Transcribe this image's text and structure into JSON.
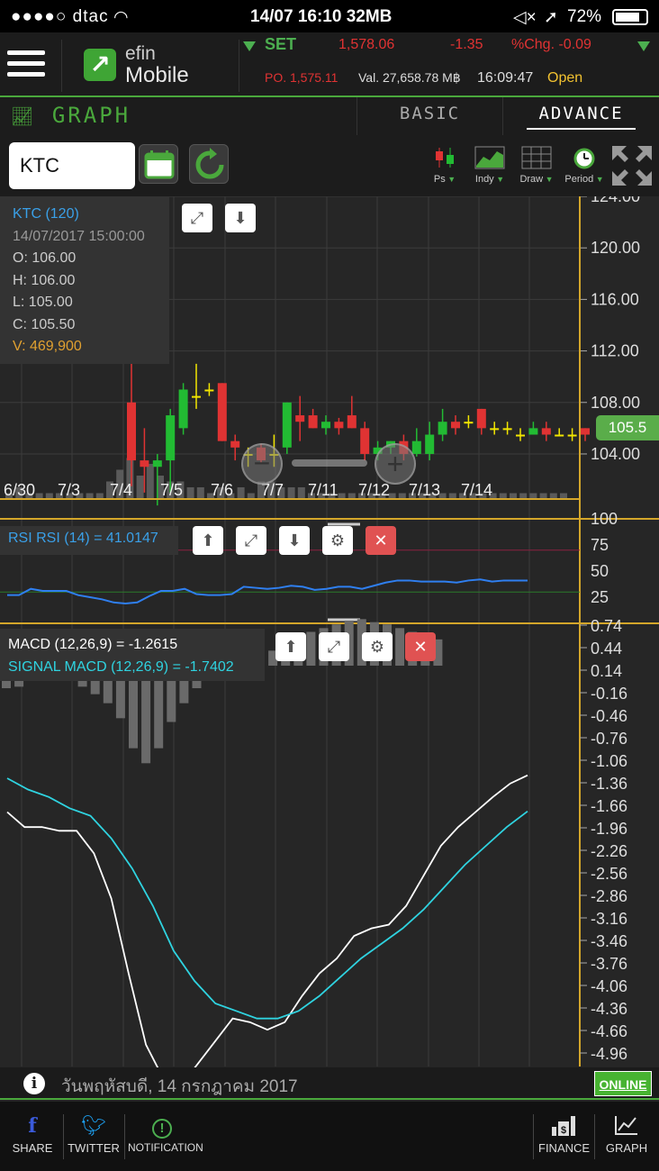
{
  "status_bar": {
    "carrier": "●●●●○ dtac",
    "time_info": "14/07 16:10 32MB",
    "battery": "72%"
  },
  "header": {
    "logo_line1": "efin",
    "logo_line2": "Mobile",
    "market_name": "SET",
    "market_value": "1,578.06",
    "market_change": "-1.35",
    "market_pct": "%Chg. -0.09",
    "projected_open": "PO. 1,575.11",
    "trade_value": "Val. 27,658.78 M฿",
    "market_time": "16:09:47",
    "market_status": "Open"
  },
  "graph_bar": {
    "title": "GRAPH",
    "tab_basic": "BASIC",
    "tab_advance": "ADVANCE"
  },
  "toolbar": {
    "symbol": "KTC",
    "ps_label": "Ps",
    "indy_label": "Indy",
    "draw_label": "Draw",
    "period_label": "Period"
  },
  "info_panel": {
    "title": "KTC (120)",
    "datetime": "14/07/2017 15:00:00",
    "open": "O: 106.00",
    "high": "H: 106.00",
    "low": "L: 105.00",
    "close": "C: 105.50",
    "volume": "V: 469,900"
  },
  "price_axis": {
    "ticks": [
      "124.00",
      "120.00",
      "116.00",
      "112.00",
      "108.00",
      "104.00"
    ],
    "current_price": "105.5"
  },
  "date_axis": [
    "6/30",
    "7/3",
    "7/4",
    "7/5",
    "7/6",
    "7/7",
    "7/11",
    "7/12",
    "7/13",
    "7/14"
  ],
  "rsi": {
    "legend": "RSI RSI (14) = 41.0147",
    "ticks": [
      "100",
      "75",
      "50",
      "25"
    ]
  },
  "macd": {
    "legend_macd": "MACD (12,26,9) = -1.2615",
    "legend_signal": "SIGNAL MACD (12,26,9) = -1.7402",
    "ticks": [
      "0.74",
      "0.44",
      "0.14",
      "-0.16",
      "-0.46",
      "-0.76",
      "-1.06",
      "-1.36",
      "-1.66",
      "-1.96",
      "-2.26",
      "-2.56",
      "-2.86",
      "-3.16",
      "-3.46",
      "-3.76",
      "-4.06",
      "-4.36",
      "-4.66",
      "-4.96"
    ]
  },
  "footer": {
    "date_text": "วันพฤหัสบดี, 14 กรกฎาคม 2017",
    "online": "ONLINE"
  },
  "bottom_nav": {
    "share": "SHARE",
    "twitter": "TWITTER",
    "notification": "NOTIFICATION",
    "finance": "FINANCE",
    "graph": "GRAPH"
  },
  "colors": {
    "up": "#22bb33",
    "down": "#e03333",
    "doji": "#f2e600",
    "accent": "#4aa83c",
    "rsi_line": "#2f7ff0",
    "signal_line": "#2fd3e0",
    "macd_line": "#ffffff"
  },
  "chart_data": {
    "type": "candlestick",
    "candles": [
      {
        "o": 108.0,
        "h": 113.0,
        "l": 101.5,
        "c": 103.5
      },
      {
        "o": 103.5,
        "h": 106.0,
        "l": 101.0,
        "c": 103.0
      },
      {
        "o": 103.0,
        "h": 104.0,
        "l": 100.0,
        "c": 103.5
      },
      {
        "o": 103.5,
        "h": 107.5,
        "l": 101.0,
        "c": 107.0
      },
      {
        "o": 106.0,
        "h": 109.5,
        "l": 105.5,
        "c": 109.0
      },
      {
        "o": 108.5,
        "h": 111.0,
        "l": 107.5,
        "c": 108.5
      },
      {
        "o": 109.0,
        "h": 109.5,
        "l": 108.5,
        "c": 109.0
      },
      {
        "o": 109.5,
        "h": 109.5,
        "l": 105.0,
        "c": 105.0
      },
      {
        "o": 105.0,
        "h": 105.5,
        "l": 103.5,
        "c": 104.5
      },
      {
        "o": 104.0,
        "h": 104.5,
        "l": 103.0,
        "c": 104.0
      },
      {
        "o": 104.5,
        "h": 104.8,
        "l": 103.2,
        "c": 103.5
      },
      {
        "o": 104.0,
        "h": 105.5,
        "l": 103.0,
        "c": 104.0
      },
      {
        "o": 104.5,
        "h": 108.0,
        "l": 104.0,
        "c": 108.0
      },
      {
        "o": 107.0,
        "h": 108.5,
        "l": 105.0,
        "c": 106.5
      },
      {
        "o": 107.0,
        "h": 107.5,
        "l": 106.0,
        "c": 106.0
      },
      {
        "o": 106.0,
        "h": 107.0,
        "l": 105.5,
        "c": 106.5
      },
      {
        "o": 106.5,
        "h": 106.8,
        "l": 105.5,
        "c": 106.0
      },
      {
        "o": 107.0,
        "h": 108.5,
        "l": 106.0,
        "c": 106.0
      },
      {
        "o": 106.0,
        "h": 106.5,
        "l": 103.5,
        "c": 104.0
      },
      {
        "o": 104.0,
        "h": 105.0,
        "l": 103.5,
        "c": 104.5
      },
      {
        "o": 104.5,
        "h": 105.0,
        "l": 104.0,
        "c": 105.0
      },
      {
        "o": 105.0,
        "h": 105.5,
        "l": 103.5,
        "c": 104.0
      },
      {
        "o": 104.0,
        "h": 106.0,
        "l": 103.8,
        "c": 105.0
      },
      {
        "o": 104.0,
        "h": 106.5,
        "l": 103.5,
        "c": 105.5
      },
      {
        "o": 105.5,
        "h": 107.5,
        "l": 105.0,
        "c": 106.5
      },
      {
        "o": 106.5,
        "h": 107.0,
        "l": 105.5,
        "c": 106.0
      },
      {
        "o": 106.5,
        "h": 107.0,
        "l": 106.0,
        "c": 106.5
      },
      {
        "o": 107.5,
        "h": 107.5,
        "l": 105.5,
        "c": 106.0
      },
      {
        "o": 106.0,
        "h": 106.5,
        "l": 105.5,
        "c": 106.0
      },
      {
        "o": 106.0,
        "h": 106.5,
        "l": 105.5,
        "c": 106.0
      },
      {
        "o": 105.5,
        "h": 106.0,
        "l": 105.0,
        "c": 105.5
      },
      {
        "o": 105.5,
        "h": 106.5,
        "l": 105.5,
        "c": 106.0
      },
      {
        "o": 106.0,
        "h": 106.5,
        "l": 105.0,
        "c": 105.5
      },
      {
        "o": 105.5,
        "h": 106.0,
        "l": 105.5,
        "c": 105.5
      },
      {
        "o": 105.5,
        "h": 106.0,
        "l": 105.0,
        "c": 105.5
      },
      {
        "o": 106.0,
        "h": 106.0,
        "l": 105.0,
        "c": 105.5
      }
    ],
    "volume": [
      1,
      2,
      1,
      1,
      1,
      1,
      1,
      1,
      1,
      1,
      3,
      5,
      7,
      4,
      6,
      4,
      3,
      3,
      2,
      2,
      1,
      2,
      1,
      2,
      1,
      3,
      3,
      2,
      2,
      2,
      1,
      1,
      1,
      1,
      1,
      1,
      1,
      1,
      1,
      1,
      1,
      1,
      1,
      1,
      1,
      1,
      1,
      1,
      1,
      1,
      1,
      1,
      1,
      1,
      1,
      1
    ],
    "rsi": [
      27,
      27,
      33,
      31,
      31,
      31,
      27,
      25,
      23,
      20,
      19,
      20,
      26,
      31,
      31,
      33,
      28,
      27,
      27,
      28,
      35,
      34,
      33,
      34,
      36,
      35,
      32,
      33,
      35,
      35,
      33,
      36,
      39,
      41,
      41,
      40,
      40,
      40,
      39,
      41,
      42,
      40,
      41,
      41,
      41
    ],
    "macd_hist": [
      -0.3,
      -0.28,
      -0.2,
      -0.16,
      -0.18,
      -0.2,
      -0.28,
      -0.38,
      -0.5,
      -0.7,
      -1.1,
      -1.3,
      -1.1,
      -0.75,
      -0.5,
      -0.3,
      -0.15,
      -0.16,
      -0.1,
      -0.06,
      0.1,
      0.2,
      0.3,
      0.4,
      0.45,
      0.5,
      0.55,
      0.6,
      0.62,
      0.58,
      0.55,
      0.5,
      0.45,
      0.42,
      0.35
    ],
    "macd_line": [
      -1.75,
      -1.95,
      -1.95,
      -2.0,
      -2.0,
      -2.3,
      -2.9,
      -3.9,
      -4.85,
      -5.3,
      -5.4,
      -5.1,
      -4.8,
      -4.5,
      -4.55,
      -4.65,
      -4.55,
      -4.2,
      -3.9,
      -3.7,
      -3.4,
      -3.3,
      -3.25,
      -3.0,
      -2.6,
      -2.2,
      -1.95,
      -1.75,
      -1.55,
      -1.37,
      -1.26
    ],
    "signal_line": [
      -1.3,
      -1.45,
      -1.55,
      -1.7,
      -1.8,
      -2.1,
      -2.5,
      -3.0,
      -3.6,
      -4.0,
      -4.3,
      -4.4,
      -4.5,
      -4.5,
      -4.4,
      -4.2,
      -3.95,
      -3.7,
      -3.5,
      -3.3,
      -3.05,
      -2.75,
      -2.45,
      -2.2,
      -1.95,
      -1.74
    ],
    "price_range": [
      100.5,
      124.0
    ],
    "rsi_range": [
      0,
      100
    ],
    "macd_range": [
      -5.14,
      0.74
    ]
  }
}
